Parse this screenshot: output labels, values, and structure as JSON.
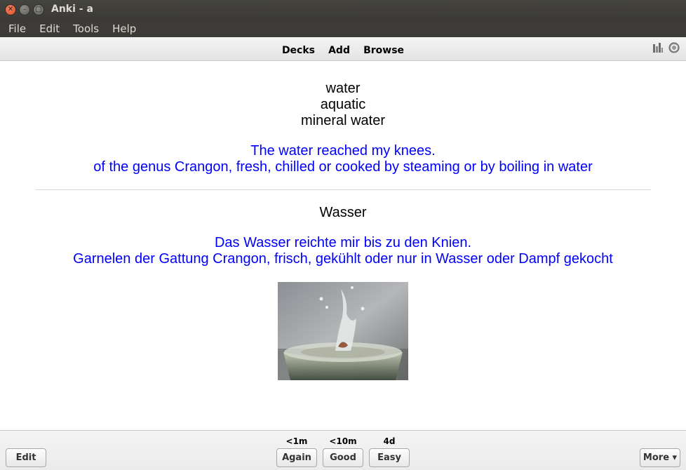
{
  "window": {
    "title": "Anki - a"
  },
  "menu": {
    "items": [
      "File",
      "Edit",
      "Tools",
      "Help"
    ]
  },
  "toolbar": {
    "links": [
      "Decks",
      "Add",
      "Browse"
    ],
    "icons": [
      "stats-icon",
      "sync-icon"
    ]
  },
  "card": {
    "front_words": [
      "water",
      "aquatic",
      "mineral water"
    ],
    "front_examples": [
      "The water reached my knees.",
      "of the genus Crangon, fresh, chilled or cooked by steaming or by boiling in water"
    ],
    "back_word": "Wasser",
    "back_examples": [
      "Das Wasser reichte mir bis zu den Knien.",
      "Garnelen der Gattung Crangon, frisch, gekühlt oder nur in Wasser oder Dampf gekocht"
    ],
    "image": "glass of water splash photo"
  },
  "bottom": {
    "edit_label": "Edit",
    "answers": [
      {
        "label": "Again",
        "interval": "<1m"
      },
      {
        "label": "Good",
        "interval": "<10m"
      },
      {
        "label": "Easy",
        "interval": "4d"
      }
    ],
    "more_label": "More ▾"
  },
  "colors": {
    "example_text": "#0000ff",
    "titlebar": "#3c3b37",
    "close_button": "#e04b1c"
  }
}
